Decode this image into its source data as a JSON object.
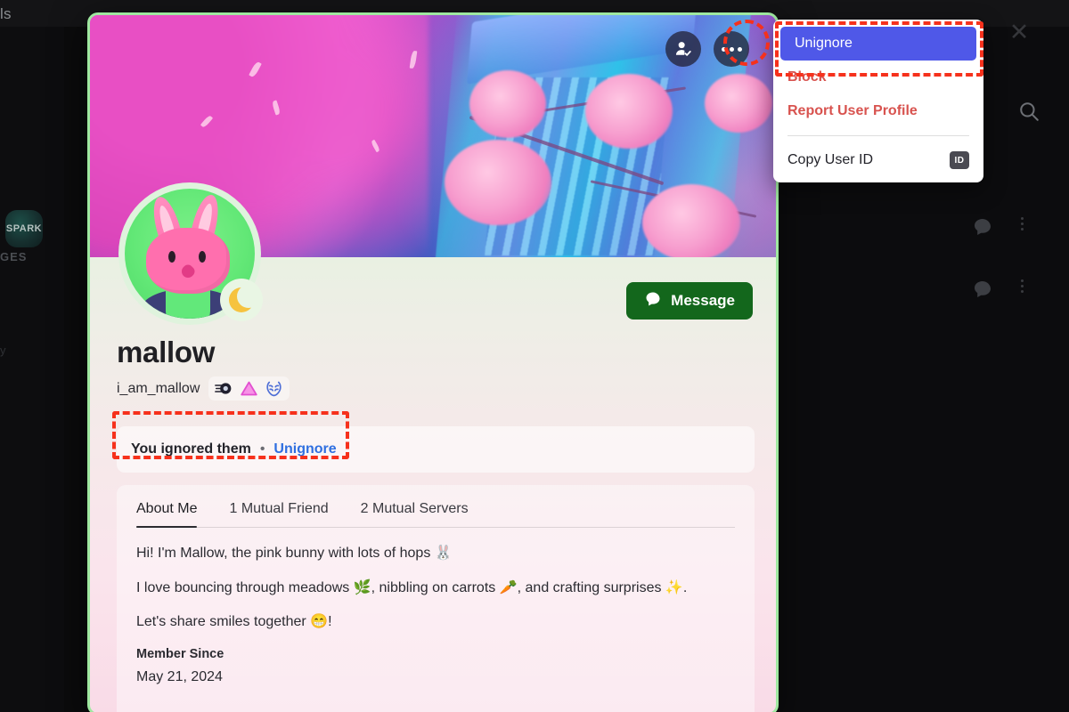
{
  "background": {
    "topbar_text": "ls",
    "server_icon_label": "SPARK",
    "section_label": "GES",
    "side_text": "y",
    "close_icon": "close-icon",
    "search_icon": "search-icon",
    "rows": [
      {
        "bubble_icon": "chat-bubble-icon",
        "overflow_icon": "vertical-dots-icon"
      },
      {
        "bubble_icon": "chat-bubble-icon",
        "overflow_icon": "vertical-dots-icon"
      }
    ]
  },
  "profile": {
    "banner_alt": "cherry-blossom-night-city-banner",
    "avatar_alt": "pink-bunny-avatar",
    "status": "idle-moon-badge",
    "actions": {
      "friend_icon": "person-check-icon",
      "more_icon": "more-options-icon"
    },
    "message_button": {
      "label": "Message",
      "icon": "speech-bubble-icon",
      "color": "#13671c"
    },
    "display_name": "mallow",
    "handle": "i_am_mallow",
    "badges": [
      {
        "name": "comet-swirl-badge",
        "color": "#2c2c3a"
      },
      {
        "name": "pink-triangle-badge",
        "color": "#f36fe0"
      },
      {
        "name": "laurel-wreath-badge",
        "color": "#4b6fd8"
      }
    ],
    "ignored_banner": {
      "text": "You ignored them",
      "separator": "•",
      "link_label": "Unignore",
      "link_color": "#2f6fe0"
    },
    "tabs": [
      {
        "label": "About Me",
        "active": true
      },
      {
        "label": "1 Mutual Friend",
        "active": false
      },
      {
        "label": "2 Mutual Servers",
        "active": false
      }
    ],
    "bio": [
      "Hi! I'm Mallow, the pink bunny with lots of hops 🐰",
      "I love bouncing through meadows 🌿, nibbling on carrots 🥕, and crafting surprises ✨.",
      "Let's share smiles together 😁!"
    ],
    "member_since_label": "Member Since",
    "member_since_value": "May 21, 2024"
  },
  "context_menu": {
    "items": [
      {
        "label": "Unignore",
        "style": "highlight"
      },
      {
        "label": "Block",
        "style": "danger"
      },
      {
        "label": "Report User Profile",
        "style": "danger"
      },
      {
        "label": "Copy User ID",
        "style": "plain",
        "chip": "ID"
      }
    ],
    "highlight_color": "#4f58e8",
    "danger_color": "#d8534f"
  },
  "annotations": {
    "color": "#f6311c",
    "targets": [
      "unignore-menu-item",
      "more-options-button",
      "ignored-status-strip"
    ]
  }
}
